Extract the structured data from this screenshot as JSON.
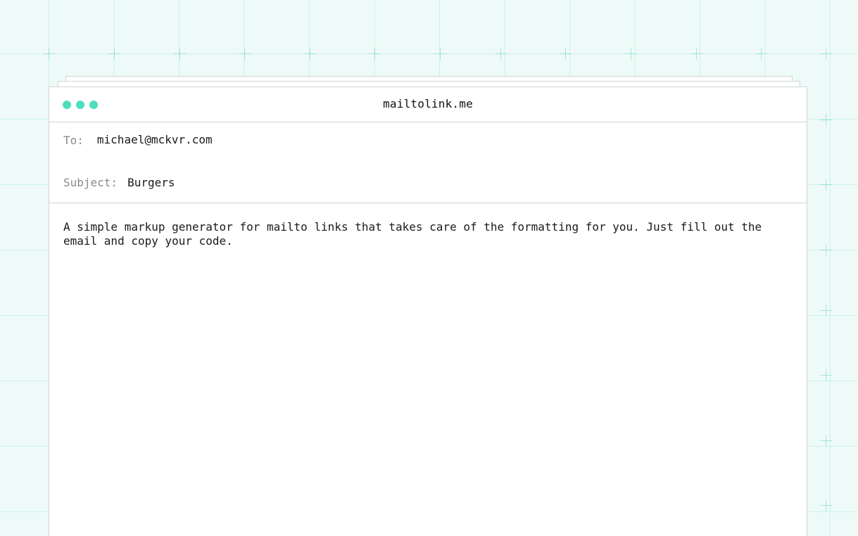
{
  "window": {
    "title": "mailtolink.me",
    "dots": [
      "window-dot",
      "window-dot",
      "window-dot"
    ]
  },
  "email": {
    "to_label": "To:",
    "to_value": "michael@mckvr.com",
    "subject_label": "Subject:",
    "subject_value": "Burgers",
    "body": "A simple markup generator for mailto links that takes care of the formatting for you. Just fill out the email and copy your code."
  },
  "colors": {
    "accent": "#4dddbf",
    "background": "#eefaf7",
    "label": "#8a8a8a"
  }
}
